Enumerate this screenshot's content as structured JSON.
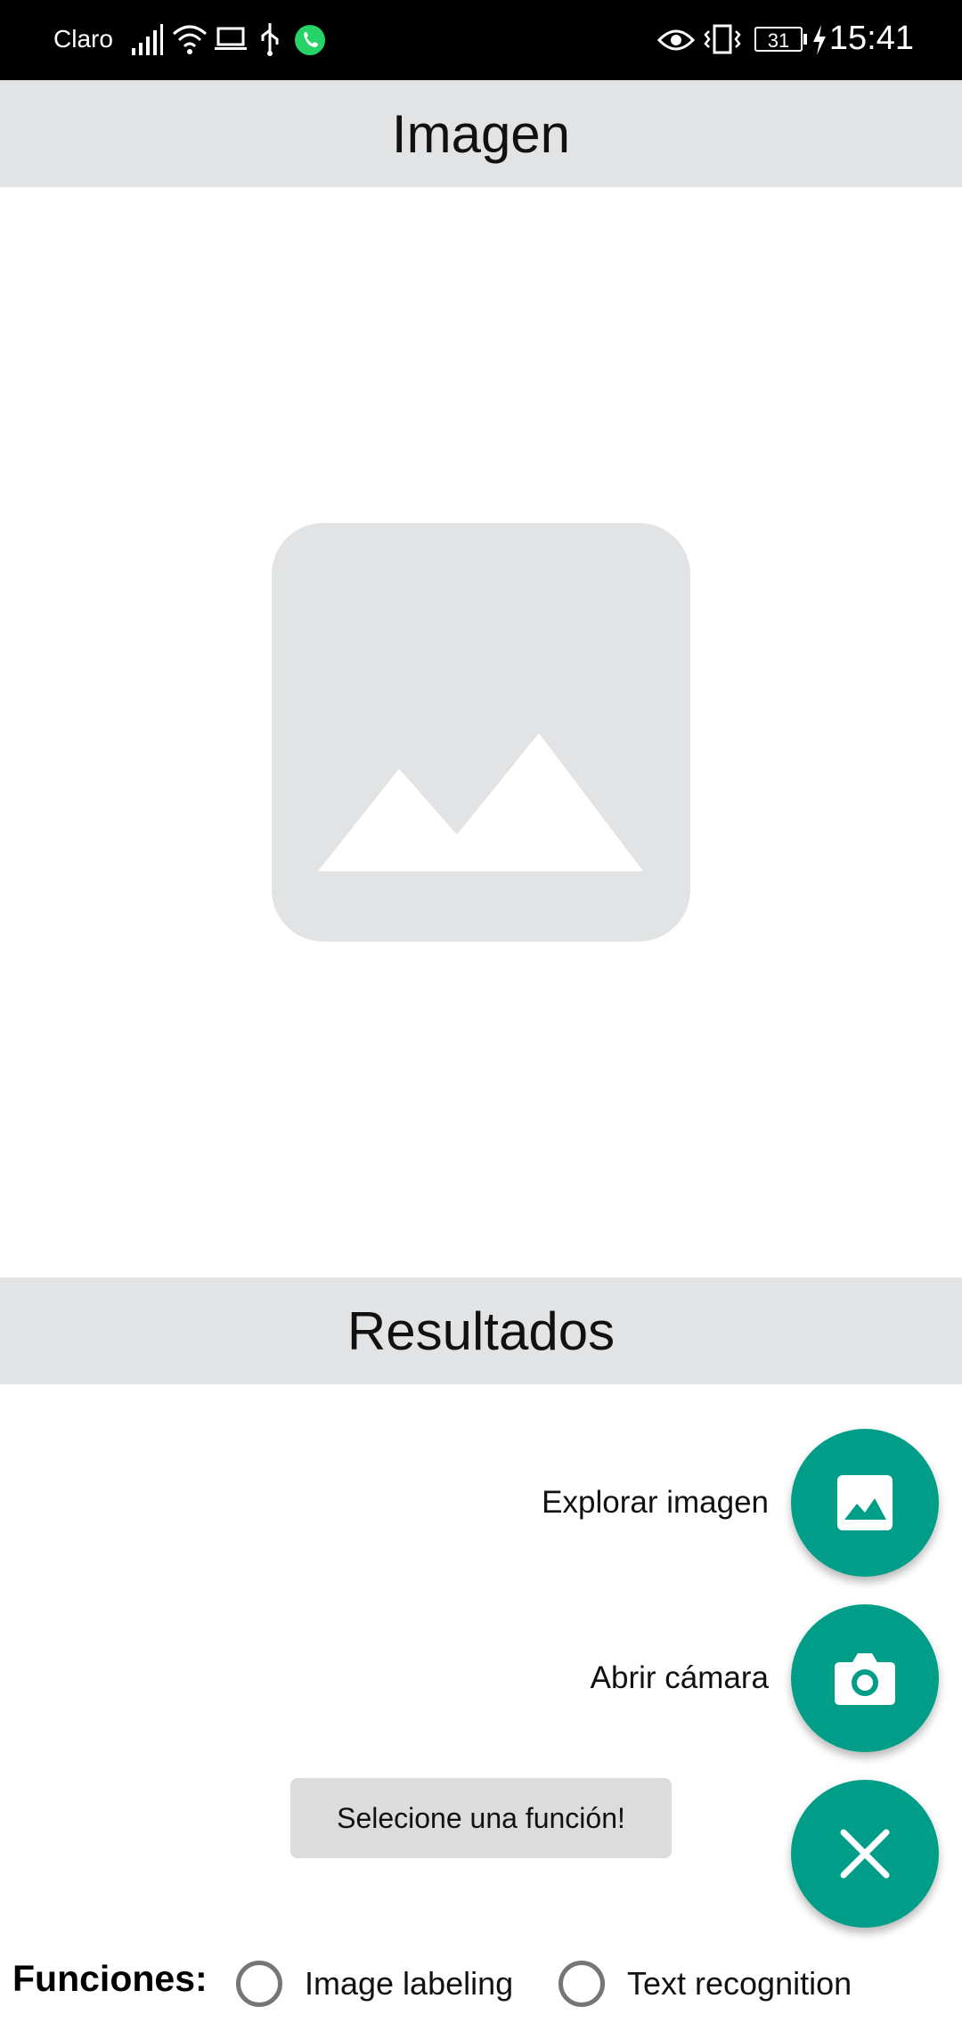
{
  "status_bar": {
    "carrier": "Claro",
    "time": "15:41",
    "battery": "31",
    "icons": [
      "signal-icon",
      "wifi-icon",
      "laptop-icon",
      "usb-icon",
      "whatsapp-icon",
      "eye-icon",
      "vibrate-icon",
      "battery-icon",
      "charging-icon"
    ]
  },
  "image_section": {
    "title": "Imagen",
    "placeholder_icon": "image-placeholder-icon"
  },
  "results_section": {
    "title": "Resultados"
  },
  "fab_menu": {
    "color": "#009e88",
    "items": [
      {
        "label": "Explorar imagen",
        "icon": "image-icon"
      },
      {
        "label": "Abrir cámara",
        "icon": "camera-icon"
      }
    ],
    "close_icon": "close-icon"
  },
  "toast": {
    "text": "Selecione una función!"
  },
  "functions": {
    "label": "Funciones:",
    "options": [
      {
        "label": "Image labeling",
        "selected": false
      },
      {
        "label": "Text recognition",
        "selected": false
      }
    ]
  }
}
